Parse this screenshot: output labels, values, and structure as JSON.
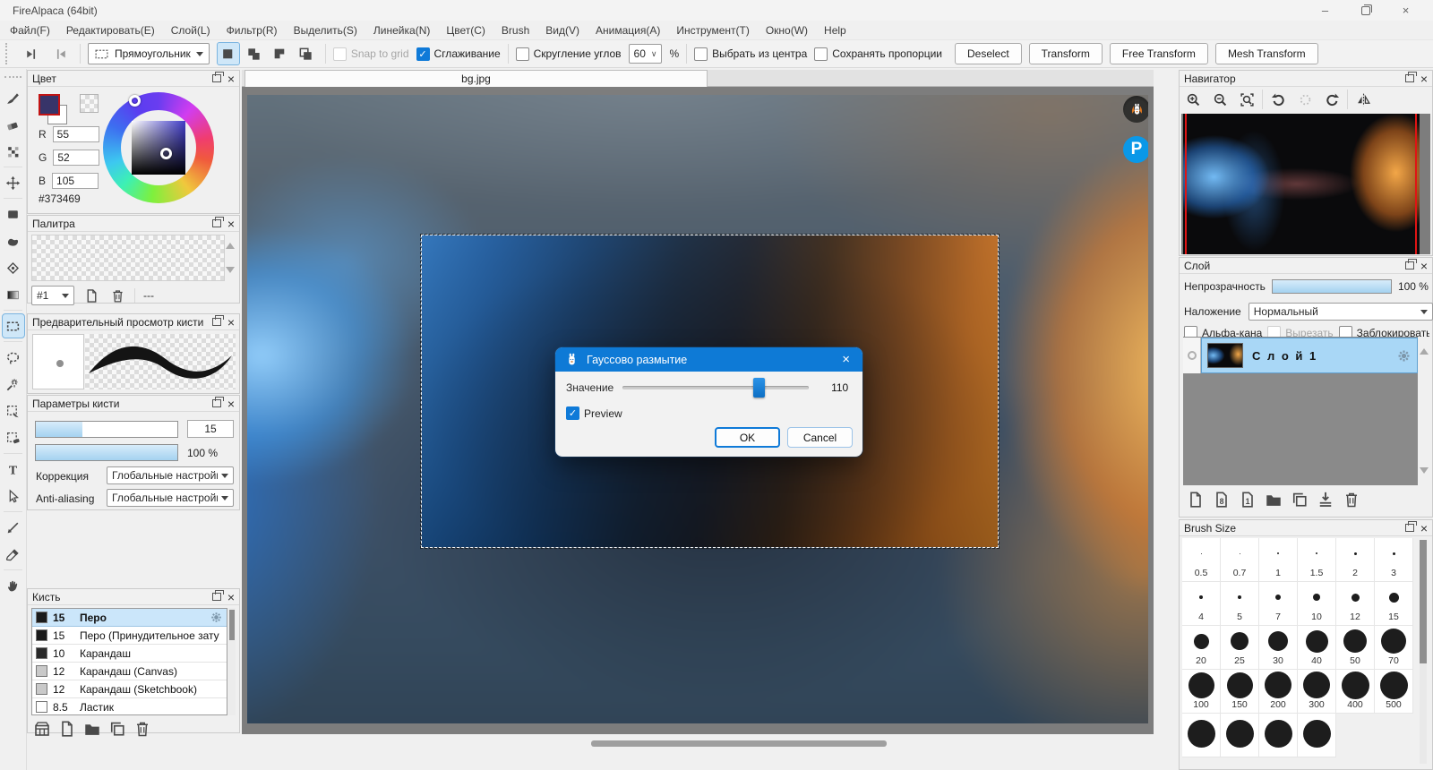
{
  "window": {
    "title": "FireAlpaca (64bit)",
    "minimize": "–",
    "close": "×"
  },
  "menu": {
    "items": [
      "Файл(F)",
      "Редактировать(E)",
      "Слой(L)",
      "Фильтр(R)",
      "Выделить(S)",
      "Линейка(N)",
      "Цвет(C)",
      "Brush",
      "Вид(V)",
      "Анимация(A)",
      "Инструмент(T)",
      "Окно(W)",
      "Help"
    ]
  },
  "toolbar": {
    "shape_value": "Прямоугольник",
    "select_ops": [
      "new-selection",
      "add-selection",
      "subtract-selection",
      "intersect-selection"
    ],
    "snap_label": "Snap to grid",
    "smooth_label": "Сглаживание",
    "round_label": "Скругление углов",
    "round_value": "60",
    "percent": "%",
    "center_label": "Выбрать из центра",
    "keep_label": "Сохранять пропорции",
    "buttons": [
      "Deselect",
      "Transform",
      "Free Transform",
      "Mesh Transform"
    ]
  },
  "tools": [
    "brush",
    "eraser",
    "dither",
    "move",
    "fill-rect",
    "bucket",
    "fill-polygon",
    "gradient",
    "select-rect",
    "select-lasso",
    "magic-wand",
    "select-pen",
    "select-eraser",
    "text",
    "operation",
    "divide",
    "eyedropper",
    "hand"
  ],
  "active_tool": "select-rect",
  "panels": {
    "color": {
      "title": "Цвет",
      "r_label": "R",
      "g_label": "G",
      "b_label": "B",
      "r": "55",
      "g": "52",
      "b": "105",
      "hex": "#373469"
    },
    "palette": {
      "title": "Палитра",
      "selector": "#1",
      "dash": "---"
    },
    "brush_preview": {
      "title": "Предварительный просмотр кисти"
    },
    "brush_params": {
      "title": "Параметры кисти",
      "size": "15",
      "opacity": "100 %",
      "correction_label": "Коррекция",
      "correction_value": "Глобальные настройки",
      "aa_label": "Anti-aliasing",
      "aa_value": "Глобальные настройки"
    },
    "brush_list": {
      "title": "Кисть",
      "items": [
        {
          "size": "15",
          "name": "Перо",
          "swatch": "#1b1b1b",
          "selected": true
        },
        {
          "size": "15",
          "name": "Перо (Принудительное зату",
          "swatch": "#1b1b1b"
        },
        {
          "size": "10",
          "name": "Карандаш",
          "swatch": "#2a2a2a"
        },
        {
          "size": "12",
          "name": "Карандаш (Canvas)",
          "swatch": "#c9c9c9"
        },
        {
          "size": "12",
          "name": "Карандаш (Sketchbook)",
          "swatch": "#c9c9c9"
        },
        {
          "size": "8.5",
          "name": "Ластик",
          "swatch": "#fdfdfd"
        }
      ],
      "footer": [
        "brush-store",
        "new-brush",
        "brush-folder",
        "duplicate-brush",
        "delete-brush"
      ]
    },
    "navigator": {
      "title": "Навигатор",
      "buttons": [
        "zoom-in",
        "zoom-out",
        "zoom-fit",
        "rotate-ccw",
        "rotate-reset",
        "rotate-cw",
        "flip-horizontal"
      ]
    },
    "layer": {
      "title": "Слой",
      "opacity_label": "Непрозрачность",
      "opacity_value": "100 %",
      "blend_label": "Наложение",
      "blend_value": "Нормальный",
      "checkboxes": [
        {
          "label": "Альфа-кана",
          "checked": false
        },
        {
          "label": "Вырезать",
          "checked": false,
          "disabled": true
        },
        {
          "label": "Заблокировать",
          "checked": false
        }
      ],
      "layers": [
        {
          "name": "С л о й 1",
          "selected": true
        }
      ],
      "footer": [
        "new-layer",
        "new-8bit-layer",
        "new-1bit-layer",
        "layer-folder",
        "duplicate-layer",
        "merge-down",
        "delete-layer"
      ]
    },
    "brush_size": {
      "title": "Brush Size",
      "sizes": [
        "0.5",
        "0.7",
        "1",
        "1.5",
        "2",
        "3",
        "4",
        "5",
        "7",
        "10",
        "12",
        "15",
        "20",
        "25",
        "30",
        "40",
        "50",
        "70",
        "100",
        "150",
        "200",
        "300",
        "400",
        "500"
      ],
      "extra_circles": 4
    }
  },
  "canvas": {
    "tab": "bg.jpg",
    "pixiv_badge": "P"
  },
  "dialog": {
    "title": "Гауссово размытие",
    "value_label": "Значение",
    "value": "110",
    "preview_label": "Preview",
    "preview_checked": true,
    "ok": "OK",
    "cancel": "Cancel"
  },
  "colors": {
    "accent": "#0f7ad8",
    "dialog_title": "#0e7ad6",
    "foreground": "#373469",
    "layer_selected": "#a9d7f6",
    "brush_row_selected": "#cbe6fa",
    "pixiv_blue": "#0a98e8",
    "canvas_frame": "#7d7d7d"
  }
}
